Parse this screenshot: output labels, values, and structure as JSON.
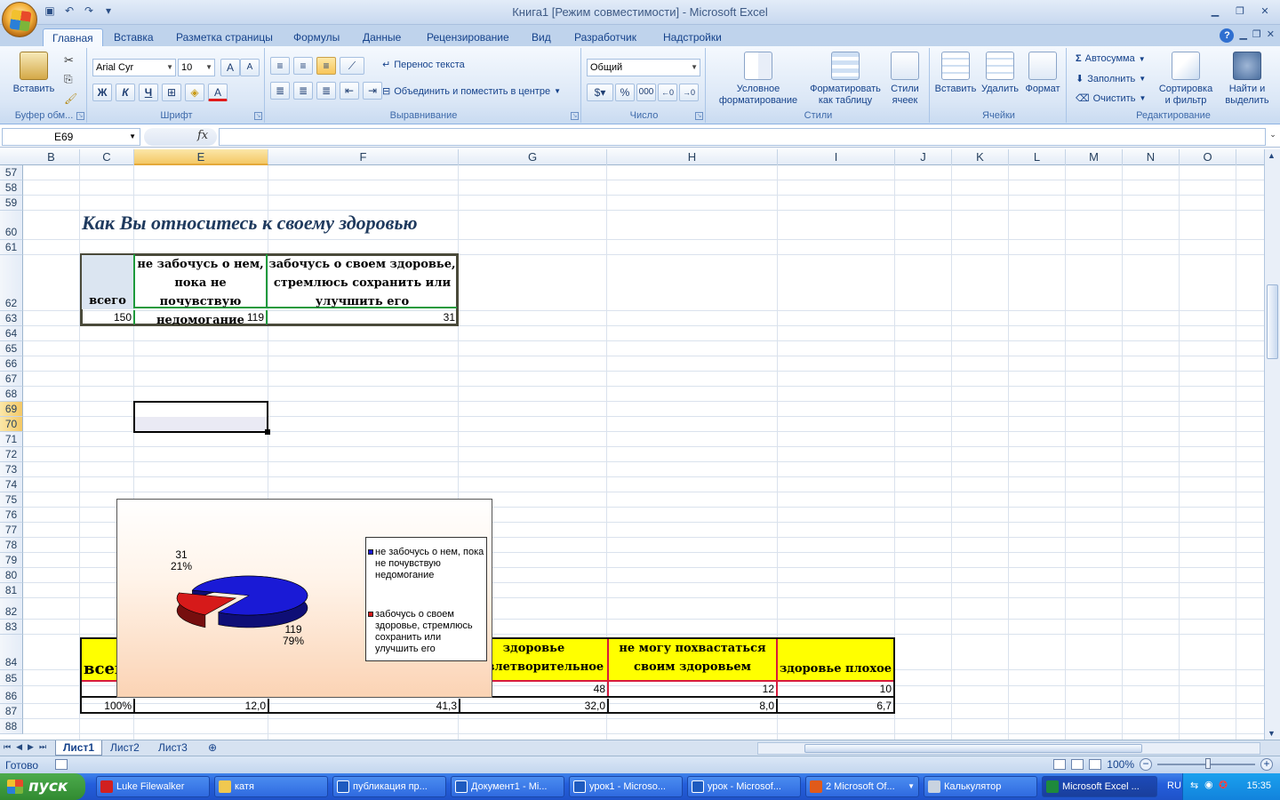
{
  "window": {
    "title": "Книга1  [Режим совместимости] - Microsoft Excel"
  },
  "ribbon_tabs": [
    "Главная",
    "Вставка",
    "Разметка страницы",
    "Формулы",
    "Данные",
    "Рецензирование",
    "Вид",
    "Разработчик",
    "Надстройки"
  ],
  "ribbon": {
    "clipboard": {
      "paste": "Вставить",
      "label": "Буфер обм..."
    },
    "font": {
      "name": "Arial Cyr",
      "size": "10",
      "bold": "Ж",
      "italic": "К",
      "underline": "Ч",
      "label": "Шрифт"
    },
    "alignment": {
      "wrap": "Перенос текста",
      "merge": "Объединить и поместить в центре",
      "label": "Выравнивание"
    },
    "number": {
      "format": "Общий",
      "percent": "%",
      "thousands": "000",
      "label": "Число"
    },
    "styles": {
      "conditional_1": "Условное",
      "conditional_2": "форматирование",
      "table_1": "Форматировать",
      "table_2": "как таблицу",
      "cell_1": "Стили",
      "cell_2": "ячеек",
      "label": "Стили"
    },
    "cells": {
      "insert": "Вставить",
      "delete": "Удалить",
      "format": "Формат",
      "label": "Ячейки"
    },
    "editing": {
      "autosum": "Автосумма",
      "fill": "Заполнить",
      "clear": "Очистить",
      "sort_1": "Сортировка",
      "sort_2": "и фильтр",
      "find_1": "Найти и",
      "find_2": "выделить",
      "label": "Редактирование"
    }
  },
  "formula_bar": {
    "name_box": "E69",
    "fx": "fx",
    "content": ""
  },
  "columns": [
    "B",
    "C",
    "E",
    "F",
    "G",
    "H",
    "I",
    "J",
    "K",
    "L",
    "M",
    "N",
    "O"
  ],
  "rows": [
    "57",
    "58",
    "59",
    "60",
    "61",
    "62",
    "63",
    "64",
    "65",
    "66",
    "67",
    "68",
    "69",
    "70",
    "71",
    "72",
    "73",
    "74",
    "75",
    "76",
    "77",
    "78",
    "79",
    "80",
    "81",
    "82",
    "83",
    "84",
    "85",
    "86",
    "87",
    "88"
  ],
  "sheet": {
    "heading": "Как Вы относитесь к своему здоровью",
    "table1": {
      "h_total": "всего",
      "h_col1": "не забочусь о нем, пока не почувствую недомогание",
      "h_col2": "забочусь о своем здоровье, стремлюсь сохранить или улучшить его",
      "v_total": "150",
      "v_col1": "119",
      "v_col2": "31"
    },
    "table2": {
      "h_total": "всего",
      "h_g_1": "здоровье",
      "h_g_2": "удовлетворительное",
      "h_h": "не могу похвастаться своим здоровьем",
      "h_i": "здоровье плохое",
      "r85_g": "48",
      "r85_h": "12",
      "r85_i": "10",
      "r86_c": "100%",
      "r86_e": "12,0",
      "r86_f": "41,3",
      "r86_g": "32,0",
      "r86_h": "8,0",
      "r86_i": "6,7"
    }
  },
  "chart_data": {
    "type": "pie",
    "categories": [
      "не забочусь о нем, пока не почувствую недомогание",
      "забочусь о своем здоровье, стремлюсь сохранить или улучшить его"
    ],
    "values": [
      119,
      31
    ],
    "percent_labels": [
      "79%",
      "21%"
    ],
    "value_labels": [
      "119",
      "31"
    ],
    "colors": [
      "#1a1ad6",
      "#d61a1a"
    ],
    "legend_position": "right",
    "three_d": true
  },
  "sheet_tabs": [
    "Лист1",
    "Лист2",
    "Лист3"
  ],
  "status": {
    "ready": "Готово",
    "zoom": "100%"
  },
  "taskbar": {
    "start": "пуск",
    "tasks": [
      "Luke Filewalker",
      "катя",
      "публикация пр...",
      "Документ1 - Mi...",
      "урок1 - Microso...",
      "урок - Microsof...",
      "2 Microsoft Of...",
      "Калькулятор",
      "Microsoft Excel ..."
    ],
    "lang": "RU",
    "clock": "15:35"
  }
}
